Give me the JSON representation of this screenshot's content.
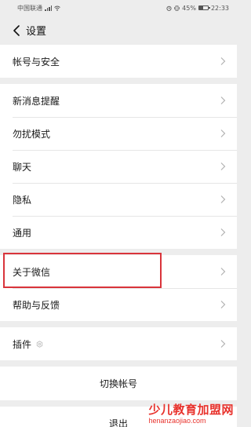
{
  "status_bar": {
    "carrier": "中国联通",
    "alarm_icon": "alarm-icon",
    "battery": "45%",
    "time": "22:33"
  },
  "nav": {
    "back_icon": "chevron-left-icon",
    "title": "设置"
  },
  "groups": [
    {
      "items": [
        {
          "label": "帐号与安全"
        }
      ]
    },
    {
      "items": [
        {
          "label": "新消息提醒"
        },
        {
          "label": "勿扰模式"
        },
        {
          "label": "聊天"
        },
        {
          "label": "隐私"
        },
        {
          "label": "通用"
        }
      ]
    },
    {
      "items": [
        {
          "label": "关于微信"
        },
        {
          "label": "帮助与反馈"
        }
      ]
    },
    {
      "items": [
        {
          "label": "插件",
          "icon": "puzzle-icon"
        }
      ]
    }
  ],
  "actions": {
    "switch_account": "切换帐号",
    "logout": "退出"
  },
  "highlight": {
    "target": "关于微信",
    "color": "#d9343b"
  },
  "watermark": {
    "title": "少儿教育加盟网",
    "url": "henanzaojiao.com",
    "color": "#e8322c"
  }
}
